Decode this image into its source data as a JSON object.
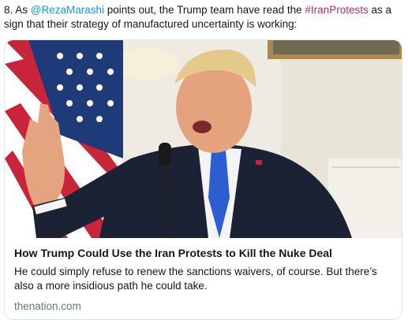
{
  "tweet": {
    "prefix": "8. As ",
    "mention": "@RezaMarashi",
    "middle": " points out, the Trump team have read the ",
    "hashtag": "#IranProtests",
    "suffix": " as a sign that their strategy of manufactured uncertainty is working:"
  },
  "card": {
    "title": "How Trump Could Use the Iran Protests to Kill the Nuke Deal",
    "description": "He could simply refuse to renew the sanctions waivers, of course. But there’s also a more insidious path he could take.",
    "domain": "thenation.com"
  },
  "colors": {
    "mention": "#1b95e0",
    "hashtag": "#c0286a",
    "domain": "#657786",
    "card_border": "#e1e8ed"
  }
}
